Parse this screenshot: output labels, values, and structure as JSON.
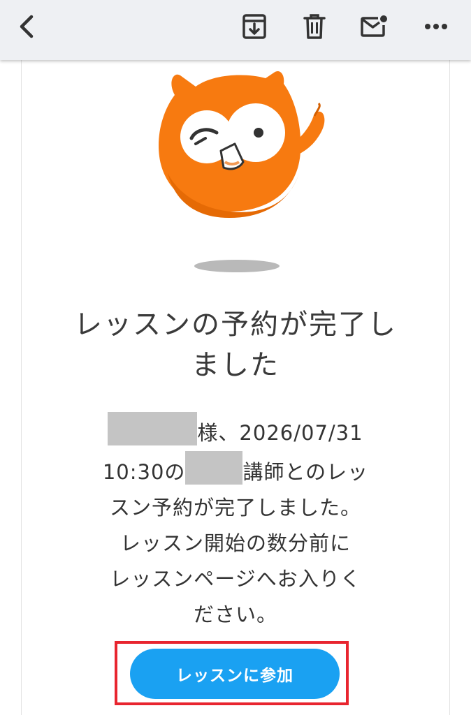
{
  "toolbar": {
    "icons": [
      "back-chevron-icon",
      "archive-icon",
      "trash-icon",
      "mark-unread-icon",
      "more-icon"
    ]
  },
  "email": {
    "headline": "レッスンの予約が完了しました",
    "body": {
      "suffix_honorific": "様、",
      "date": "2026/07/31",
      "time": "10:30",
      "particle_no": "の",
      "teacher_suffix": "講師とのレッ",
      "line3": "スン予約が完了しました。",
      "line4": "レッスン開始の数分前に",
      "line5": "レッスンページへお入りく",
      "line6": "ださい。"
    },
    "join_button_label": "レッスンに参加"
  },
  "colors": {
    "toolbar_bg": "#eef0f3",
    "mascot_orange": "#f77a10",
    "button_blue": "#1aa1f2",
    "highlight_red": "#e8252f",
    "redaction_gray": "#c4c4c4"
  }
}
